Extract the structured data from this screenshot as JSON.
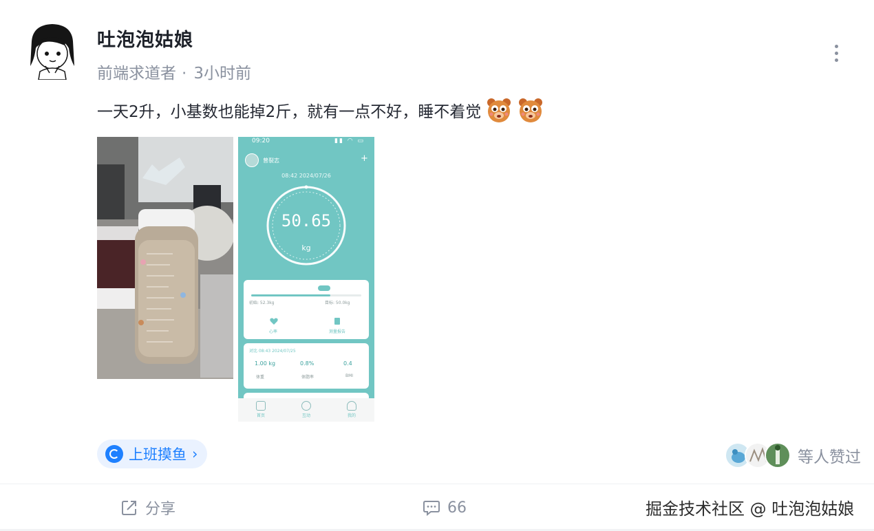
{
  "author": {
    "name": "吐泡泡姑娘",
    "title": "前端求道者",
    "separator": "·",
    "time": "3小时前"
  },
  "post": {
    "text": "一天2升，小基数也能掉2斤，就有一点不好，睡不着觉",
    "emojis": [
      "bear-face-emoji",
      "bear-face-emoji"
    ]
  },
  "phone_screen": {
    "status_time": "09:20",
    "user": "曾裂志",
    "datetime": "08:42 2024/07/26",
    "weight": "50.65",
    "unit": "kg",
    "progress_start": "初始: 52.3kg",
    "progress_goal": "目标: 50.0kg",
    "progress_fraction": 0.72,
    "compare_line": "对比 08:43 2024/07/25",
    "metrics": [
      {
        "value": "1.00 kg",
        "label": "体重"
      },
      {
        "value": "0.8%",
        "label": "体脂率"
      },
      {
        "value": "0.4",
        "label": "BMI"
      }
    ],
    "card_actions": [
      "心率",
      "测量报告"
    ],
    "tabs": [
      "首页",
      "互动",
      "我的"
    ]
  },
  "topic": {
    "label": "上班摸鱼",
    "chevron": "›"
  },
  "likes": {
    "text": "等人赞过",
    "count_avatars": 3
  },
  "actions": {
    "share": "分享",
    "comments": "66"
  },
  "watermark": "掘金技术社区 @ 吐泡泡姑娘",
  "colors": {
    "accent": "#1e80ff",
    "muted": "#8a919f",
    "phone_teal": "#71c6c3"
  }
}
